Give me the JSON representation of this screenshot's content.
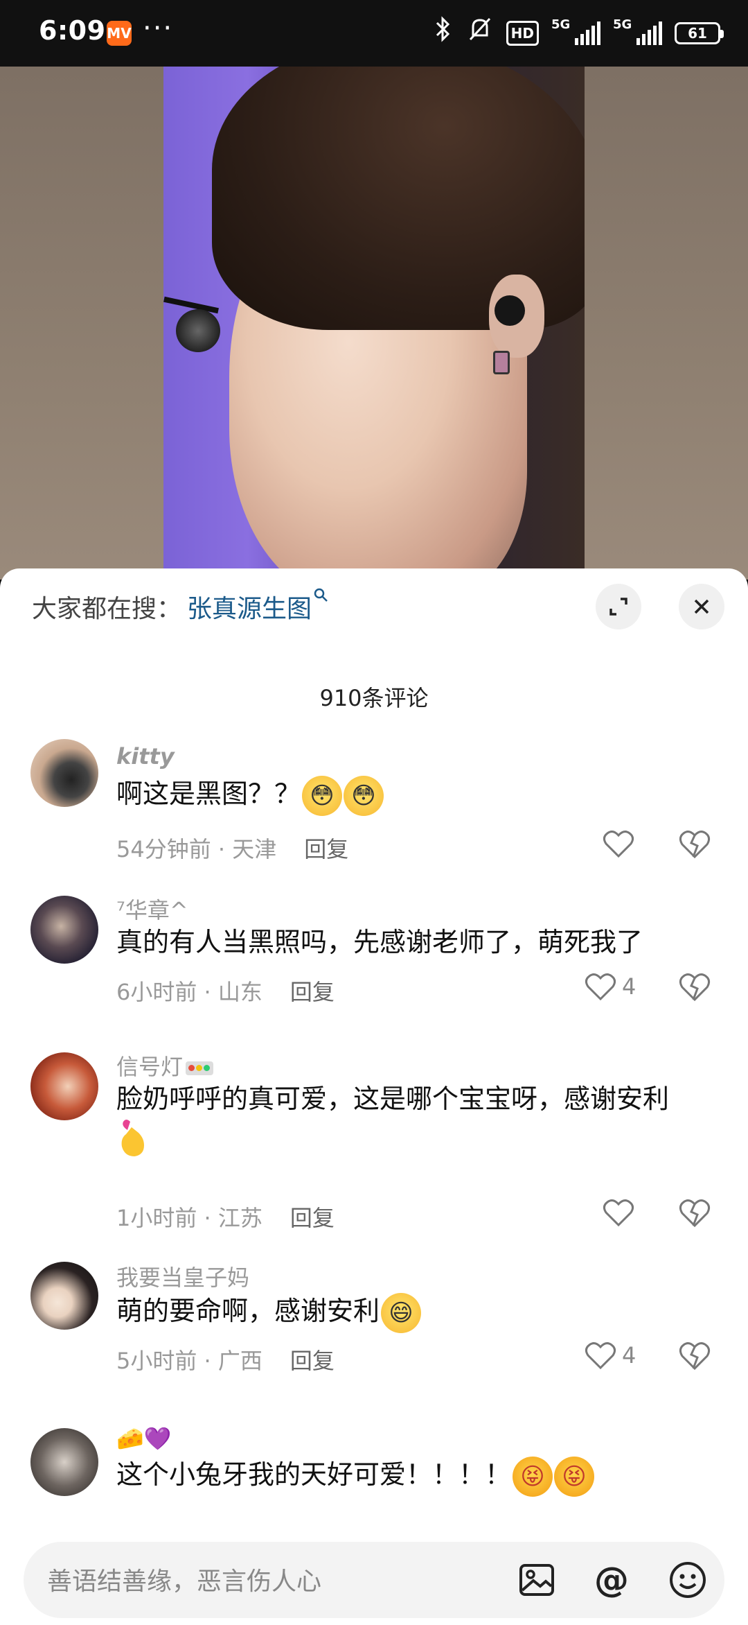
{
  "status_bar": {
    "time": "6:09",
    "app_icon_label": "MV",
    "more": "···",
    "network_hd": "HD",
    "signal1": "5G",
    "signal2": "5G",
    "battery": "61"
  },
  "sheet": {
    "search_prefix": "大家都在搜：",
    "search_term": "张真源生图",
    "comment_count": "910条评论"
  },
  "comments": [
    {
      "username": "kitty",
      "text": "啊这是黑图？？",
      "time": "54分钟前",
      "location": "天津",
      "reply": "回复",
      "likes": ""
    },
    {
      "username": "⁷华章^",
      "text": "真的有人当黑照吗，先感谢老师了，萌死我了",
      "time": "6小时前",
      "location": "山东",
      "reply": "回复",
      "likes": "4"
    },
    {
      "username": "信号灯",
      "text": "脸奶呼呼的真可爱，这是哪个宝宝呀，感谢安利",
      "time": "1小时前",
      "location": "江苏",
      "reply": "回复",
      "likes": ""
    },
    {
      "username": "我要当皇子妈",
      "text": "萌的要命啊，感谢安利",
      "time": "5小时前",
      "location": "广西",
      "reply": "回复",
      "likes": "4"
    },
    {
      "username": "🧀💜",
      "text": "这个小兔牙我的天好可爱！！！！",
      "time": "",
      "location": "",
      "reply": "",
      "likes": ""
    }
  ],
  "input": {
    "placeholder": "善语结善缘，恶言伤人心",
    "at_symbol": "@"
  },
  "colors": {
    "accent_link": "#1b5a8a",
    "muted_text": "#999999",
    "sheet_bg": "#ffffff"
  }
}
